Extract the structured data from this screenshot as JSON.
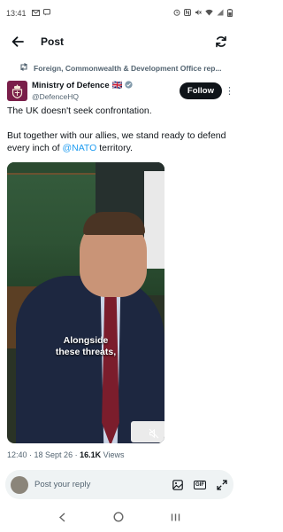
{
  "status_bar": {
    "time": "13:41",
    "left_icons": [
      "mail-icon",
      "message-icon"
    ],
    "right_icons": [
      "alarm-icon",
      "nfc-icon",
      "mute-icon",
      "wifi-icon",
      "signal-icon",
      "battery-icon"
    ]
  },
  "header": {
    "title": "Post",
    "back_icon": "arrow-left-icon",
    "refresh_icon": "refresh-icon"
  },
  "repost_banner": {
    "icon": "repost-icon",
    "text": "Foreign, Commonwealth & Development Office rep..."
  },
  "author": {
    "name": "Ministry of Defence",
    "flag": "🇬🇧",
    "handle": "@DefenceHQ",
    "verified_color": "#829aab",
    "follow_label": "Follow",
    "more_icon": "more-vertical-icon"
  },
  "tweet": {
    "line1": "The UK doesn't seek confrontation.",
    "line2_before": "But together with our allies, we stand ready to defend every inch of ",
    "mention": "@NATO",
    "line2_after": " territory."
  },
  "media": {
    "caption_line1": "Alongside",
    "caption_line2": "these threats,",
    "mute_icon": "volume-off-icon"
  },
  "meta": {
    "time": "12:40",
    "sep": " · ",
    "date": "18 Sept 26",
    "views_count": "16.1K",
    "views_label": " Views"
  },
  "reply_bar": {
    "placeholder": "Post your reply",
    "image_icon": "image-icon",
    "gif_label": "GIF",
    "expand_icon": "expand-icon"
  },
  "colors": {
    "accent": "#1d9bf0",
    "text": "#0f1419",
    "muted": "#536471",
    "avatar_bg": "#7a1f4a"
  }
}
